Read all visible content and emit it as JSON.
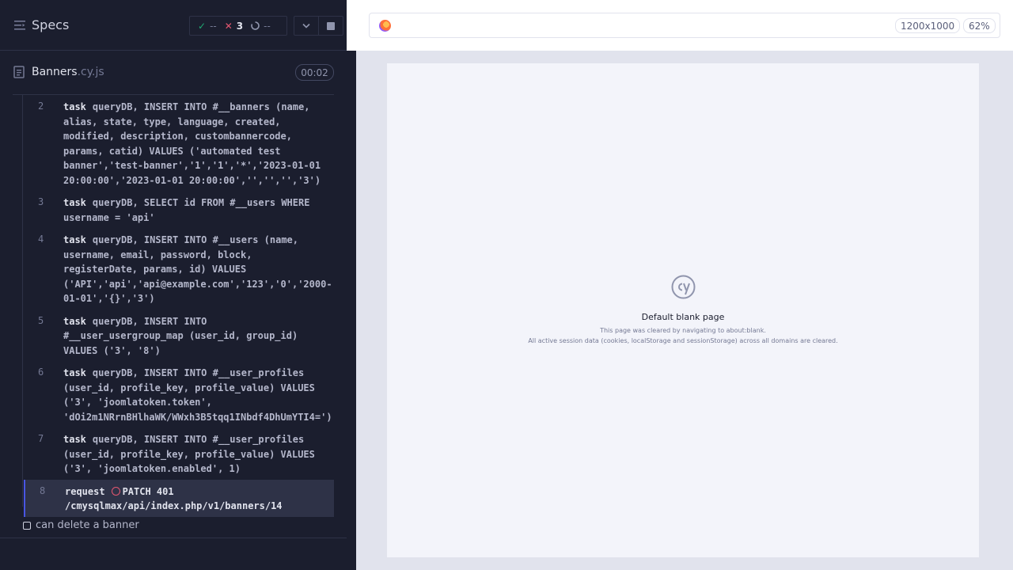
{
  "reporter": {
    "title": "Specs",
    "stats": {
      "passed": "--",
      "failed": "3",
      "pending": "--"
    },
    "file": {
      "name": "Banners",
      "ext": ".cy.js",
      "duration": "00:02"
    },
    "commands": [
      {
        "num": "2",
        "name": "task",
        "message": "queryDB, INSERT INTO #__banners (name, alias, state, type, language, created, modified, description, custombannercode, params, catid) VALUES ('automated test banner','test-banner','1','1','*','2023-01-01 20:00:00','2023-01-01 20:00:00','','','','3')"
      },
      {
        "num": "3",
        "name": "task",
        "message": "queryDB, SELECT id FROM #__users WHERE username = 'api'"
      },
      {
        "num": "4",
        "name": "task",
        "message": "queryDB, INSERT INTO #__users (name, username, email, password, block, registerDate, params, id) VALUES ('API','api','api@example.com','123','0','2000-01-01','{}','3')"
      },
      {
        "num": "5",
        "name": "task",
        "message": "queryDB, INSERT INTO #__user_usergroup_map (user_id, group_id) VALUES ('3', '8')"
      },
      {
        "num": "6",
        "name": "task",
        "message": "queryDB, INSERT INTO #__user_profiles (user_id, profile_key, profile_value) VALUES ('3', 'joomlatoken.token', 'dOi2m1NRrnBHlhaWK/WWxh3B5tqq1INbdf4DhUmYTI4=')"
      },
      {
        "num": "7",
        "name": "task",
        "message": "queryDB, INSERT INTO #__user_profiles (user_id, profile_key, profile_value) VALUES ('3', 'joomlatoken.enabled', 1)"
      },
      {
        "num": "8",
        "name": "request",
        "message": "PATCH 401 /cmysqlmax/api/index.php/v1/banners/14"
      }
    ],
    "test_title": "can delete a banner"
  },
  "aut": {
    "viewport_size": "1200x1000",
    "zoom": "62%",
    "blank_title": "Default blank page",
    "blank_line1": "This page was cleared by navigating to about:blank.",
    "blank_line2": "All active session data (cookies, localStorage and sessionStorage) across all domains are cleared."
  },
  "colors": {
    "passed": "#1fa971",
    "failed": "#e45770",
    "accent": "#4956e3"
  }
}
